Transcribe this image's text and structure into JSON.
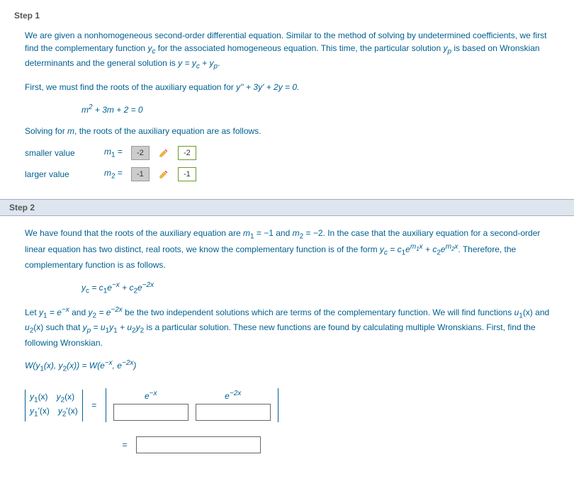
{
  "step1": {
    "header": "Step 1",
    "p1_a": "We are given a nonhomogeneous second-order differential equation. Similar to the method of solving by undetermined coefficients, we first find the complementary function ",
    "p1_yc": "y",
    "p1_yc_sub": "c",
    "p1_b": " for the associated homogeneous equation. This time, the particular solution ",
    "p1_yp": "y",
    "p1_yp_sub": "p",
    "p1_c": " is based on Wronskian determinants and the general solution is ",
    "p1_eq": "y = y",
    "p1_eq_c": "c",
    "p1_plus": " + y",
    "p1_eq_p": "p",
    "p1_end": ".",
    "p2_a": "First, we must find the roots of the auxiliary equation for ",
    "p2_eq": "y'' + 3y' + 2y = 0.",
    "aux_eq_a": "m",
    "aux_eq_sup": "2",
    "aux_eq_b": " + 3m + 2 = 0",
    "p3": "Solving for m, the roots of the auxiliary equation are as follows.",
    "smaller_label": "smaller value",
    "larger_label": "larger value",
    "m1_var": "m",
    "m1_sub": "1",
    "m2_var": "m",
    "m2_sub": "2",
    "eq": " = ",
    "m1_ans": "-2",
    "m1_hint": "-2",
    "m2_ans": "-1",
    "m2_hint": "-1"
  },
  "step2": {
    "header": "Step 2",
    "p1_a": "We have found that the roots of the auxiliary equation are ",
    "m1": "m",
    "m1s": "1",
    "m1v": " = −1",
    "and": " and ",
    "m2": "m",
    "m2s": "2",
    "m2v": " = −2",
    "p1_b": ". In the case that the auxiliary equation for a second-order linear equation has two distinct, real roots, we know the complementary function is of the form ",
    "form_a": "y",
    "form_as": "c",
    "form_b": " = c",
    "form_bs": "1",
    "form_c": "e",
    "form_cs": "m",
    "form_cs2": "1",
    "form_cx": "x",
    "form_d": " + c",
    "form_ds": "2",
    "form_e": "e",
    "form_es": "m",
    "form_es2": "2",
    "form_ex": "x",
    "p1_c": ". Therefore, the complementary function is as follows.",
    "yc_a": "y",
    "yc_as": "c",
    "yc_eq": " = c",
    "yc_1": "1",
    "yc_e1": "e",
    "yc_ex1": "−x",
    "yc_plus": " + c",
    "yc_2": "2",
    "yc_e2": "e",
    "yc_ex2": "−2x",
    "p2_a": "Let ",
    "y1": "y",
    "y1s": "1",
    "y1v": " = e",
    "y1e": "−x",
    "p2_and": " and ",
    "y2": "y",
    "y2s": "2",
    "y2v": " = e",
    "y2e": "−2x",
    "p2_b": " be the two independent solutions which are terms of the complementary function. We will find functions ",
    "u1": "u",
    "u1s": "1",
    "u1x": "(x)",
    "p2_and2": " and ",
    "u2": "u",
    "u2s": "2",
    "u2x": "(x)",
    "p2_c": " such that ",
    "yp": "y",
    "yps": "p",
    "ypv": " = u",
    "yp1": "1",
    "ypy1": "y",
    "ypy1s": "1",
    "ypplus": " + u",
    "yp2": "2",
    "ypy2": "y",
    "ypy2s": "2",
    "p2_d": " is a particular solution. These new functions are found by calculating multiple Wronskians. First, find the following Wronskian.",
    "W_a": "W(y",
    "W_1": "1",
    "W_b": "(x), y",
    "W_2": "2",
    "W_c": "(x))  =  W(e",
    "W_e1": "−x",
    "W_d": ", e",
    "W_e2": "−2x",
    "W_e": ")",
    "det_r1c1_a": "y",
    "det_r1c1_s": "1",
    "det_r1c1_b": "(x)",
    "det_r1c2_a": "y",
    "det_r1c2_s": "2",
    "det_r1c2_b": "(x)",
    "det_r2c1_a": "y",
    "det_r2c1_s": "1",
    "det_r2c1_b": "'(x)",
    "det_r2c2_a": "y",
    "det_r2c2_s": "2",
    "det_r2c2_b": "'(x)",
    "col1_a": "e",
    "col1_e": "−x",
    "col2_a": "e",
    "col2_e": "−2x",
    "equals": "="
  }
}
